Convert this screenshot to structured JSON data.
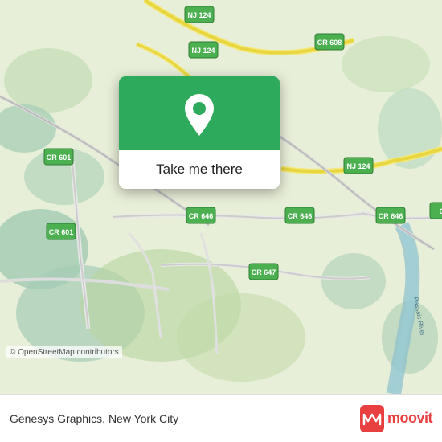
{
  "map": {
    "attribution": "© OpenStreetMap contributors",
    "background_color": "#e8f0d8"
  },
  "popup": {
    "button_label": "Take me there",
    "green_color": "#2eaa5c"
  },
  "bottom_bar": {
    "location_text": "Genesys Graphics, New York City",
    "moovit_label": "moovit"
  },
  "road_labels": [
    "NJ 124",
    "NJ 124",
    "NJ 124",
    "CR 608",
    "CR 601",
    "CR 601",
    "CR 646",
    "CR 646",
    "CR 646",
    "CR 647"
  ]
}
